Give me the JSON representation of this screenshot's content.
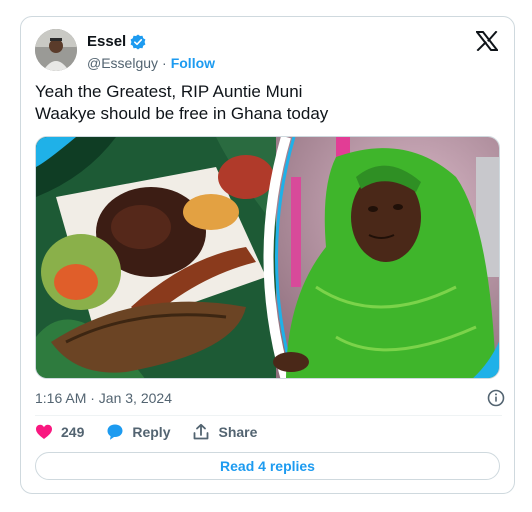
{
  "author": {
    "name": "Essel",
    "handle": "@Esselguy",
    "separator": "·",
    "follow_label": "Follow"
  },
  "tweet": {
    "line1": "Yeah the Greatest, RIP Auntie Muni",
    "line2": "Waakye should be free in Ghana today"
  },
  "meta": {
    "timestamp": "1:16 AM · Jan 3, 2024"
  },
  "actions": {
    "likes_count": "249",
    "reply_label": "Reply",
    "share_label": "Share"
  },
  "footer": {
    "read_replies_label": "Read 4 replies"
  },
  "colors": {
    "accent": "#1d9bf0",
    "like": "#f91880",
    "muted": "#536471"
  }
}
